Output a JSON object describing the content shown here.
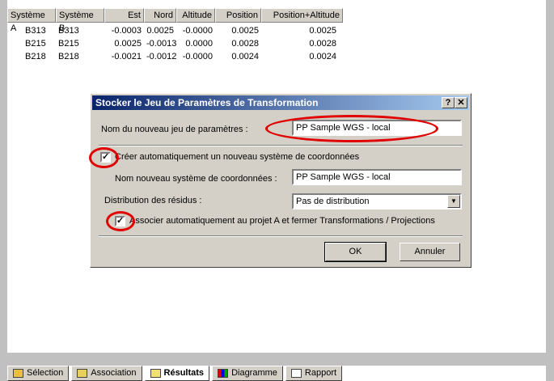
{
  "table": {
    "headers": [
      "Système A",
      "Système B",
      "Est",
      "Nord",
      "Altitude",
      "Position",
      "Position+Altitude"
    ],
    "rows": [
      [
        "B313",
        "B313",
        "-0.0003",
        "0.0025",
        "-0.0000",
        "0.0025",
        "0.0025"
      ],
      [
        "B215",
        "B215",
        "0.0025",
        "-0.0013",
        "0.0000",
        "0.0028",
        "0.0028"
      ],
      [
        "B218",
        "B218",
        "-0.0021",
        "-0.0012",
        "-0.0000",
        "0.0024",
        "0.0024"
      ]
    ]
  },
  "dialog": {
    "title": "Stocker le Jeu de Paramètres de Transformation",
    "help_label": "?",
    "close_label": "✕",
    "param_set_label": "Nom du nouveau jeu de paramètres :",
    "param_set_value": "PP Sample WGS - local",
    "create_system_checked_mark": "✓",
    "create_system_label": "Créer automatiquement un nouveau système de coordonnées",
    "system_name_label": "Nom nouveau système de coordonnées :",
    "system_name_value": "PP Sample WGS - local",
    "residuals_label": "Distribution des résidus :",
    "residuals_value": "Pas de distribution",
    "associate_checked_mark": "✓",
    "associate_label": "Associer automatiquement au projet A et fermer Transformations / Projections",
    "ok_label": "OK",
    "cancel_label": "Annuler"
  },
  "tabs": [
    {
      "label": "Sélection",
      "icon": "selection-icon"
    },
    {
      "label": "Association",
      "icon": "association-icon"
    },
    {
      "label": "Résultats",
      "icon": "results-icon",
      "active": true
    },
    {
      "label": "Diagramme",
      "icon": "chart-icon"
    },
    {
      "label": "Rapport",
      "icon": "report-icon"
    }
  ],
  "highlight_color": "#e00000",
  "titlebar_color": "#0a246a"
}
